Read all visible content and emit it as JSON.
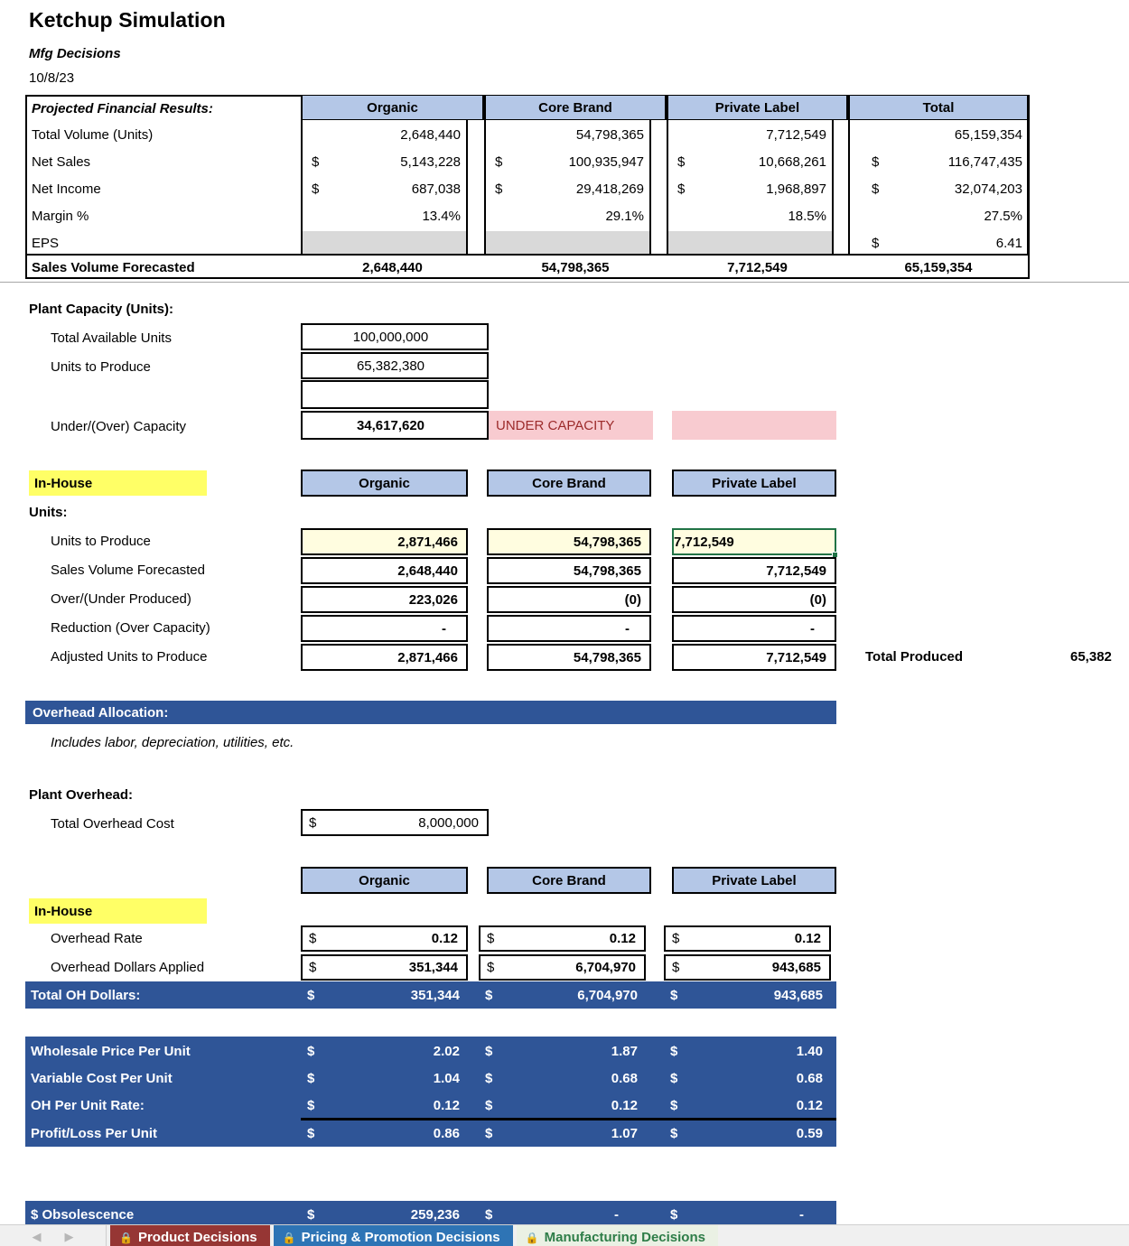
{
  "header": {
    "title": "Ketchup Simulation",
    "subtitle": "Mfg Decisions",
    "date": "10/8/23"
  },
  "financial_table": {
    "row_header": "Projected Financial Results:",
    "columns": [
      "Organic",
      "Core Brand",
      "Private Label",
      "Total"
    ],
    "rows": [
      {
        "label": "Total Volume (Units)",
        "values": [
          "2,648,440",
          "54,798,365",
          "7,712,549",
          "65,159,354"
        ],
        "dollar": [
          false,
          false,
          false,
          false
        ]
      },
      {
        "label": "Net Sales",
        "values": [
          "5,143,228",
          "100,935,947",
          "10,668,261",
          "116,747,435"
        ],
        "dollar": [
          true,
          true,
          true,
          true
        ]
      },
      {
        "label": "Net Income",
        "values": [
          "687,038",
          "29,418,269",
          "1,968,897",
          "32,074,203"
        ],
        "dollar": [
          true,
          true,
          true,
          true
        ]
      },
      {
        "label": "Margin %",
        "values": [
          "13.4%",
          "29.1%",
          "18.5%",
          "27.5%"
        ],
        "dollar": [
          false,
          false,
          false,
          false
        ]
      },
      {
        "label": "EPS",
        "values": [
          "",
          "",
          "",
          "6.41"
        ],
        "dollar": [
          false,
          false,
          false,
          true
        ]
      }
    ],
    "footer": {
      "label": "Sales Volume Forecasted",
      "values": [
        "2,648,440",
        "54,798,365",
        "7,712,549",
        "65,159,354"
      ]
    }
  },
  "plant_capacity": {
    "section_label": "Plant Capacity (Units):",
    "rows": [
      {
        "label": "Total Available Units",
        "value": "100,000,000"
      },
      {
        "label": "Units to Produce",
        "value": "65,382,380"
      },
      {
        "label": "",
        "value": ""
      },
      {
        "label": "Under/(Over) Capacity",
        "value": "34,617,620"
      }
    ],
    "status": "UNDER CAPACITY"
  },
  "in_house_units": {
    "badge": "In-House",
    "section_label": "Units:",
    "columns": [
      "Organic",
      "Core Brand",
      "Private Label"
    ],
    "rows": [
      {
        "label": "Units to Produce",
        "values": [
          "2,871,466",
          "54,798,365",
          "7,712,549"
        ],
        "highlight": true
      },
      {
        "label": "Sales Volume Forecasted",
        "values": [
          "2,648,440",
          "54,798,365",
          "7,712,549"
        ],
        "highlight": false
      },
      {
        "label": "Over/(Under Produced)",
        "values": [
          "223,026",
          "(0)",
          "(0)"
        ],
        "highlight": false
      },
      {
        "label": "Reduction (Over Capacity)",
        "values": [
          "-",
          "-",
          "-"
        ],
        "highlight": false
      },
      {
        "label": "Adjusted Units to Produce",
        "values": [
          "2,871,466",
          "54,798,365",
          "7,712,549"
        ],
        "highlight": false
      }
    ],
    "total_produced_label": "Total Produced",
    "total_produced_value": "65,382"
  },
  "overhead": {
    "section_bar": "Overhead Allocation:",
    "note": "Includes labor, depreciation, utilities, etc.",
    "plant_overhead_label": "Plant Overhead:",
    "total_overhead_cost_label": "Total Overhead Cost",
    "total_overhead_cost_value": "8,000,000",
    "columns": [
      "Organic",
      "Core Brand",
      "Private Label"
    ],
    "badge": "In-House",
    "rows": [
      {
        "label": "Overhead Rate",
        "values": [
          "0.12",
          "0.12",
          "0.12"
        ]
      },
      {
        "label": "Overhead Dollars Applied",
        "values": [
          "351,344",
          "6,704,970",
          "943,685"
        ]
      }
    ],
    "total_row": {
      "label": "Total OH Dollars:",
      "values": [
        "351,344",
        "6,704,970",
        "943,685"
      ]
    }
  },
  "per_unit": {
    "rows": [
      {
        "label": "Wholesale Price Per Unit",
        "values": [
          "2.02",
          "1.87",
          "1.40"
        ]
      },
      {
        "label": "Variable Cost Per Unit",
        "values": [
          "1.04",
          "0.68",
          "0.68"
        ]
      },
      {
        "label": " OH Per Unit Rate:",
        "values": [
          "0.12",
          "0.12",
          "0.12"
        ]
      },
      {
        "label": "Profit/Loss Per Unit",
        "values": [
          "0.86",
          "1.07",
          "0.59"
        ]
      }
    ]
  },
  "obsolescence": {
    "label": "$ Obsolescence",
    "values": [
      "259,236",
      "-",
      "-"
    ]
  },
  "tabs": [
    {
      "label": "Product Decisions",
      "color": "red",
      "icon": "lock-icon"
    },
    {
      "label": "Pricing & Promotion Decisions",
      "color": "blue",
      "icon": "lock-icon"
    },
    {
      "label": "Manufacturing Decisions",
      "color": "green",
      "icon": "lock-icon"
    }
  ],
  "nav": {
    "prev": "◀",
    "next": "▶"
  },
  "colors": {
    "header_blue": "#b4c7e7",
    "navy": "#2f5597",
    "pink": "#f8cbd0",
    "yellow": "#ffff66",
    "selection_green": "#217346",
    "pink_text": "#9c2b2b"
  }
}
